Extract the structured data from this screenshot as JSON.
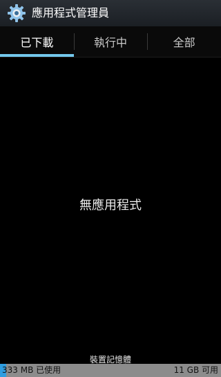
{
  "app_title": "應用程式管理員",
  "app_icon": "gear-icon",
  "tabs": [
    {
      "label": "已下載",
      "active": true
    },
    {
      "label": "執行中",
      "active": false
    },
    {
      "label": "全部",
      "active": false
    }
  ],
  "empty_message": "無應用程式",
  "storage": {
    "label": "裝置記憶體",
    "used_text": "333 MB 已使用",
    "free_text": "11 GB 可用",
    "used_fraction": 0.028
  },
  "colors": {
    "tab_indicator": "#74c8ec",
    "storage_used": "#2f9de0",
    "storage_free": "#8c8c8c"
  }
}
